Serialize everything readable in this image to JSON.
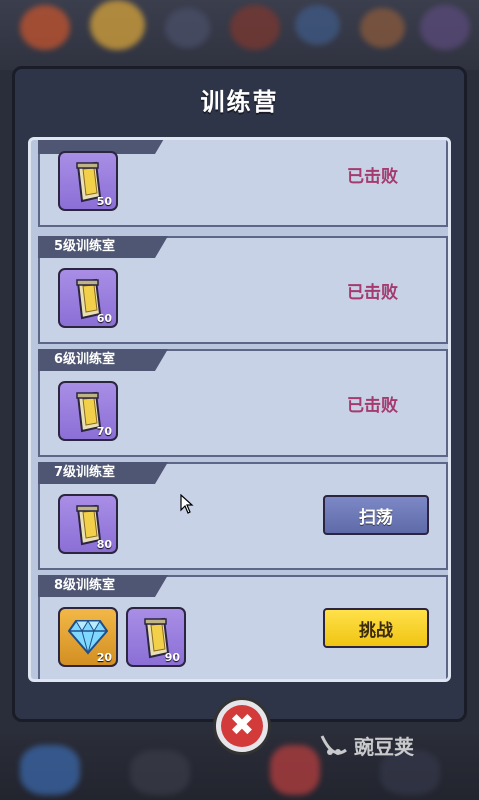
{
  "dialog": {
    "title": "训练营"
  },
  "rooms": [
    {
      "label": "",
      "rewards": [
        {
          "type": "scroll",
          "count": "50"
        }
      ],
      "status": "已击败"
    },
    {
      "label": "5级训练室",
      "rewards": [
        {
          "type": "scroll",
          "count": "60"
        }
      ],
      "status": "已击败"
    },
    {
      "label": "6级训练室",
      "rewards": [
        {
          "type": "scroll",
          "count": "70"
        }
      ],
      "status": "已击败"
    },
    {
      "label": "7级训练室",
      "rewards": [
        {
          "type": "scroll",
          "count": "80"
        }
      ],
      "button": "扫荡"
    },
    {
      "label": "8级训练室",
      "rewards": [
        {
          "type": "diamond",
          "count": "20"
        },
        {
          "type": "scroll",
          "count": "90"
        }
      ],
      "button": "挑战"
    }
  ],
  "colors": {
    "defeated": "#a43a6e",
    "sweep_button": "#6a75b5",
    "challenge_button": "#f5d12a",
    "close_button": "#d33a3a"
  },
  "icons": {
    "close": "close-icon",
    "scroll": "scroll-icon",
    "diamond": "diamond-icon"
  },
  "watermark": "豌豆荚"
}
